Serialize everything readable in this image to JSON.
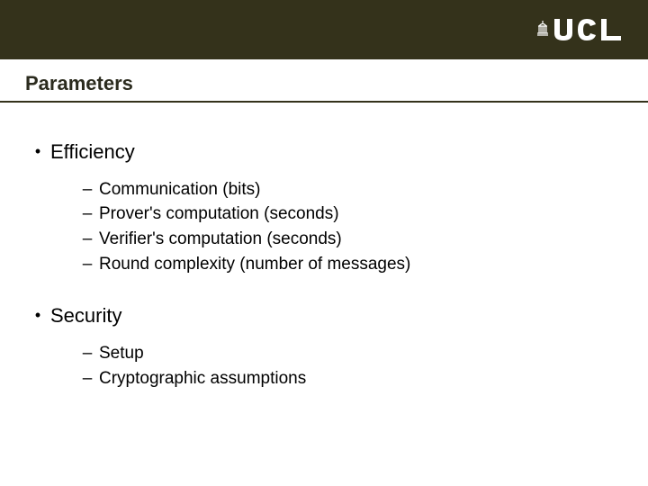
{
  "logo_text": "UCL",
  "title": "Parameters",
  "items": [
    {
      "label": "Efficiency",
      "sub": [
        "Communication (bits)",
        "Prover's computation (seconds)",
        "Verifier's computation (seconds)",
        "Round complexity (number of messages)"
      ]
    },
    {
      "label": "Security",
      "sub": [
        "Setup",
        "Cryptographic assumptions"
      ]
    }
  ]
}
